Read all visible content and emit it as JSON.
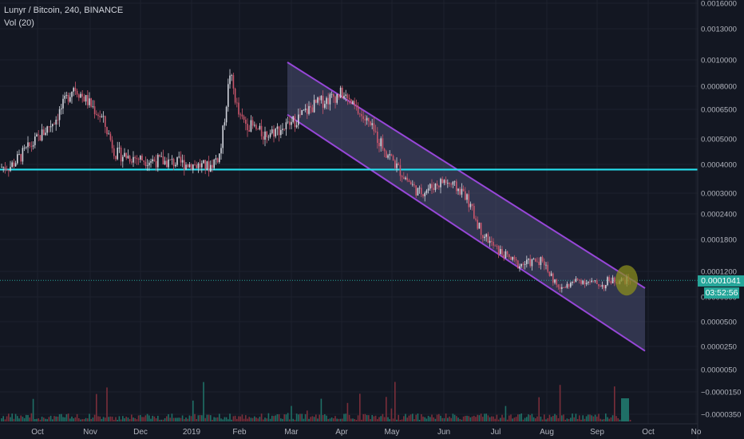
{
  "legend": {
    "symbol": "Lunyr / Bitcoin, 240, BINANCE",
    "volume": "Vol (20)"
  },
  "colors": {
    "background": "#131722",
    "grid": "#1e222d",
    "axis_text": "#b2b5be",
    "support_line": "#26e1f0",
    "channel_border": "#9747d8",
    "channel_fill": "#4a4e73",
    "candle_up": "#d1d4dc",
    "candle_down": "#c9556b",
    "current_price": "#26a69a",
    "circle_fill": "#8a8c1e",
    "volume_up": "#1f6f66",
    "volume_down": "#7a2e3a"
  },
  "price_tag": {
    "current": "0.0001041",
    "countdown": "03:52:56"
  },
  "chart_data": {
    "type": "candlestick",
    "y_scale": "log",
    "price_ticks": [
      "0.0016000",
      "0.0013000",
      "0.0010000",
      "0.0008000",
      "0.0006500",
      "0.0005000",
      "0.0004000",
      "0.0003000",
      "0.0002400",
      "0.0001800",
      "0.0001200",
      "0.0000800",
      "0.0000500",
      "0.0000250",
      "0.0000050",
      "−0.0000150",
      "−0.0000350"
    ],
    "x_ticks": [
      "Oct",
      "Nov",
      "Dec",
      "2019",
      "Feb",
      "Mar",
      "Apr",
      "May",
      "Jun",
      "Jul",
      "Aug",
      "Sep",
      "Oct",
      "No"
    ],
    "support_level": 0.00038,
    "current_price": 0.0001041,
    "channel": {
      "upper_start": {
        "date": "Mar",
        "price": 0.00098
      },
      "upper_end": {
        "date": "Sep end",
        "price": 9.2e-05
      },
      "lower_start": {
        "date": "Mar",
        "price": 0.00062
      },
      "lower_end": {
        "date": "Sep end",
        "price": 2.2e-05
      }
    },
    "path": [
      {
        "x": "Sep mid",
        "p": 0.00039
      },
      {
        "x": "Oct",
        "p": 0.0005
      },
      {
        "x": "Oct mid",
        "p": 0.0006
      },
      {
        "x": "Late Oct",
        "p": 0.0008
      },
      {
        "x": "Nov",
        "p": 0.00068
      },
      {
        "x": "Nov mid",
        "p": 0.0006
      },
      {
        "x": "Late Nov",
        "p": 0.00044
      },
      {
        "x": "Dec",
        "p": 0.00042
      },
      {
        "x": "Dec mid",
        "p": 0.00041
      },
      {
        "x": "2019",
        "p": 0.0004
      },
      {
        "x": "Jan mid",
        "p": 0.00039
      },
      {
        "x": "Jan 20",
        "p": 0.00044
      },
      {
        "x": "Late Jan",
        "p": 0.0009
      },
      {
        "x": "Feb",
        "p": 0.0006
      },
      {
        "x": "Feb mid",
        "p": 0.00052
      },
      {
        "x": "Mar",
        "p": 0.00056
      },
      {
        "x": "Mar mid",
        "p": 0.00068
      },
      {
        "x": "Apr",
        "p": 0.00075
      },
      {
        "x": "Apr mid",
        "p": 0.00058
      },
      {
        "x": "May",
        "p": 0.00036
      },
      {
        "x": "May mid",
        "p": 0.0003
      },
      {
        "x": "Jun",
        "p": 0.00034
      },
      {
        "x": "Jun mid",
        "p": 0.0003
      },
      {
        "x": "Late Jun",
        "p": 0.0002
      },
      {
        "x": "Jul",
        "p": 0.00016
      },
      {
        "x": "Jul mid",
        "p": 0.00013
      },
      {
        "x": "Late Jul",
        "p": 0.00014
      },
      {
        "x": "Aug",
        "p": 9e-05
      },
      {
        "x": "Aug mid",
        "p": 0.000105
      },
      {
        "x": "Sep",
        "p": 9.5e-05
      },
      {
        "x": "Sep mid",
        "p": 0.000104
      }
    ]
  }
}
